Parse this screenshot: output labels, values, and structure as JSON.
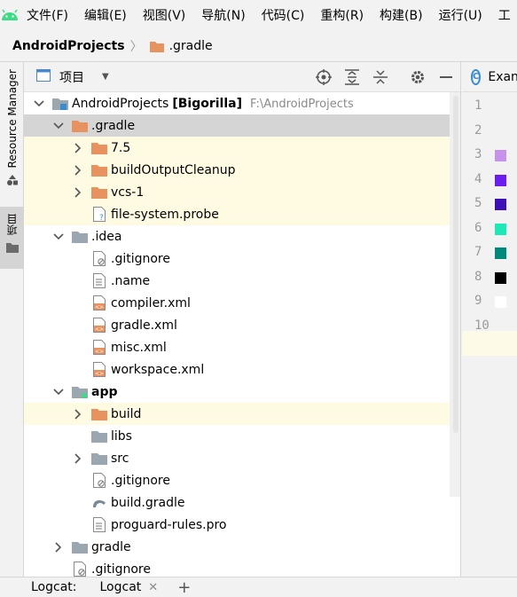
{
  "menu": [
    "文件(F)",
    "编辑(E)",
    "视图(V)",
    "导航(N)",
    "代码(C)",
    "重构(R)",
    "构建(B)",
    "运行(U)",
    "工"
  ],
  "breadcrumb": {
    "root": "AndroidProjects",
    "folder": ".gradle"
  },
  "side": {
    "resource_manager": "Resource Manager",
    "project": "项目"
  },
  "panel": {
    "title": "项目"
  },
  "tree": [
    {
      "name": "AndroidProjects",
      "extra": "[Bigorilla]",
      "path": "F:\\AndroidProjects",
      "level": 0,
      "arrow": "down",
      "icon": "module-folder-icon",
      "state": ""
    },
    {
      "name": ".gradle",
      "level": 1,
      "arrow": "down",
      "icon": "folder-orange-icon",
      "state": "selected"
    },
    {
      "name": "7.5",
      "level": 2,
      "arrow": "right",
      "icon": "folder-orange-icon",
      "state": "highlight"
    },
    {
      "name": "buildOutputCleanup",
      "level": 2,
      "arrow": "right",
      "icon": "folder-orange-icon",
      "state": "highlight"
    },
    {
      "name": "vcs-1",
      "level": 2,
      "arrow": "right",
      "icon": "folder-orange-icon",
      "state": "highlight"
    },
    {
      "name": "file-system.probe",
      "level": 2,
      "arrow": "",
      "icon": "unknown-file-icon",
      "state": "highlight"
    },
    {
      "name": ".idea",
      "level": 1,
      "arrow": "down",
      "icon": "folder-gray-icon",
      "state": ""
    },
    {
      "name": ".gitignore",
      "level": 2,
      "arrow": "",
      "icon": "ignored-file-icon",
      "state": ""
    },
    {
      "name": ".name",
      "level": 2,
      "arrow": "",
      "icon": "text-file-icon",
      "state": ""
    },
    {
      "name": "compiler.xml",
      "level": 2,
      "arrow": "",
      "icon": "xml-file-icon",
      "state": ""
    },
    {
      "name": "gradle.xml",
      "level": 2,
      "arrow": "",
      "icon": "xml-file-icon",
      "state": ""
    },
    {
      "name": "misc.xml",
      "level": 2,
      "arrow": "",
      "icon": "xml-file-icon",
      "state": ""
    },
    {
      "name": "workspace.xml",
      "level": 2,
      "arrow": "",
      "icon": "xml-file-icon",
      "state": ""
    },
    {
      "name": "app",
      "level": 1,
      "arrow": "down",
      "icon": "module-app-icon",
      "state": "",
      "bold": true
    },
    {
      "name": "build",
      "level": 2,
      "arrow": "right",
      "icon": "folder-orange-icon",
      "state": "highlight"
    },
    {
      "name": "libs",
      "level": 2,
      "arrow": "",
      "icon": "folder-gray-icon",
      "state": ""
    },
    {
      "name": "src",
      "level": 2,
      "arrow": "right",
      "icon": "folder-gray-icon",
      "state": ""
    },
    {
      "name": ".gitignore",
      "level": 2,
      "arrow": "",
      "icon": "ignored-file-icon",
      "state": ""
    },
    {
      "name": "build.gradle",
      "level": 2,
      "arrow": "",
      "icon": "gradle-file-icon",
      "state": ""
    },
    {
      "name": "proguard-rules.pro",
      "level": 2,
      "arrow": "",
      "icon": "text-file-icon",
      "state": ""
    },
    {
      "name": "gradle",
      "level": 1,
      "arrow": "right",
      "icon": "folder-gray-icon",
      "state": ""
    },
    {
      "name": ".gitignore",
      "level": 1,
      "arrow": "",
      "icon": "ignored-file-icon",
      "state": ""
    }
  ],
  "editor": {
    "tab_label": "Exan",
    "lines": [
      "1",
      "2",
      "3",
      "4",
      "5",
      "6",
      "7",
      "8",
      "9",
      "10"
    ],
    "swatches": [
      "",
      "",
      "#c792ea",
      "#6a1ff0",
      "#3f0fb6",
      "#1de9b6",
      "#00897b",
      "#000000",
      "#ffffff",
      ""
    ]
  },
  "bottom": {
    "label": "Logcat:",
    "tab": "Logcat"
  },
  "colors": {
    "folder_orange": "#e8935f",
    "folder_gray": "#9aa7b0",
    "highlight": "#fffbe3",
    "selected": "#d5d5d5"
  }
}
